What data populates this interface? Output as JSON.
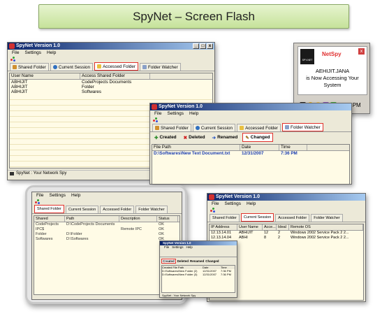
{
  "banner": {
    "title": "SpyNet – Screen Flash"
  },
  "colors": {
    "titlebar": "#0a246a",
    "highlight": "#e0302a",
    "grid_bg": "#fffbe6",
    "banner_bg": "#c6e29a"
  },
  "win_close_glyph": "x",
  "win_min_glyph": "_",
  "win_max_glyph": "□",
  "main_window": {
    "title": "SpyNet Version 1.0",
    "menu": [
      "File",
      "Settings",
      "Help"
    ],
    "tabs": [
      {
        "label": "Shared Folder",
        "icon": "shared-folder-icon"
      },
      {
        "label": "Current Session",
        "icon": "session-icon"
      },
      {
        "label": "Accessed Folder",
        "icon": "folder-icon"
      },
      {
        "label": "Folder Watcher",
        "icon": "watcher-icon"
      }
    ],
    "columns": [
      "User Name",
      "Access Shared Folder"
    ],
    "rows": [
      [
        "ABHIJIT",
        "CodeProjects Documents"
      ],
      [
        "ABHIJIT",
        "Folder"
      ],
      [
        "ABHIJIT",
        "Softwares"
      ]
    ],
    "status": "SpyNet : Your Network Spy"
  },
  "netspy_popup": {
    "brand": "NetSpy",
    "logo_text": "SPY-NET",
    "line1": "AEHIJIT.JANA",
    "line2": "is Now Accessing Your",
    "line3": "System",
    "tray_time": "7:57 PM"
  },
  "watcher_window": {
    "title": "SpyNet Version 1.0",
    "menu": [
      "File",
      "Settings",
      "Help"
    ],
    "tabs": [
      {
        "label": "Shared Folder"
      },
      {
        "label": "Current Session"
      },
      {
        "label": "Accessed Folder"
      },
      {
        "label": "Folder Watcher"
      }
    ],
    "subtabs": [
      {
        "label": "Created",
        "icon": "created-icon"
      },
      {
        "label": "Deleted",
        "icon": "deleted-icon"
      },
      {
        "label": "Renamed",
        "icon": "renamed-icon"
      },
      {
        "label": "Changed",
        "icon": "changed-icon"
      }
    ],
    "columns": [
      "File Path",
      "Date",
      "Time"
    ],
    "rows": [
      [
        "D:\\Softwares\\New Text Document.txt",
        "12/31/2007",
        "7:36 PM"
      ]
    ]
  },
  "shared_window": {
    "menu": [
      "File",
      "Settings",
      "Help"
    ],
    "tabs": [
      {
        "label": "Shared Folder"
      },
      {
        "label": "Current Session"
      },
      {
        "label": "Accessed Folder"
      },
      {
        "label": "Folder Watcher"
      }
    ],
    "columns": [
      "Shared",
      "Path",
      "Description",
      "Status"
    ],
    "rows": [
      [
        "CodeProjects",
        "D:\\CodeProjects Documents",
        "",
        "OK"
      ],
      [
        "IPC$",
        "",
        "Remote IPC",
        "OK"
      ],
      [
        "Folder",
        "D:\\Folder",
        "",
        "OK"
      ],
      [
        "Softwares",
        "D:\\Softwares",
        "",
        "OK"
      ]
    ]
  },
  "session_window": {
    "title": "SpyNet Version 1.0",
    "menu": [
      "File",
      "Settings",
      "Help"
    ],
    "tabs": [
      {
        "label": "Shared Folder"
      },
      {
        "label": "Current Session"
      },
      {
        "label": "Accessed Folder"
      },
      {
        "label": "Folder Watcher"
      }
    ],
    "columns": [
      "IP Address",
      "User Name",
      "Acce...",
      "Ideal",
      "Remote OS"
    ],
    "rows": [
      [
        "12.13.14.01",
        "ABHIJIT",
        "12",
        "2",
        "Windows 2002 Service Pack 2 2..."
      ],
      [
        "12.13.14.04",
        "ABHI",
        "8",
        "2",
        "Windows 2002 Service Pack 2 2..."
      ]
    ]
  },
  "mini_window": {
    "title": "SpyNet Version 1.0",
    "menu": [
      "File",
      "Settings",
      "Help"
    ],
    "subtabs": [
      {
        "label": "Created"
      },
      {
        "label": "Deleted"
      },
      {
        "label": "Renamed"
      },
      {
        "label": "Changed"
      }
    ],
    "columns": [
      "Created File Path",
      "Date",
      "Time"
    ],
    "rows": [
      [
        "D:\\Softwares\\New Folder (2)",
        "12/31/2007",
        "7:36 PM"
      ],
      [
        "D:\\Softwares\\New Folder (3)",
        "12/31/2007",
        "7:36 PM"
      ]
    ],
    "status": "SpyNet : Your Network Spy"
  }
}
